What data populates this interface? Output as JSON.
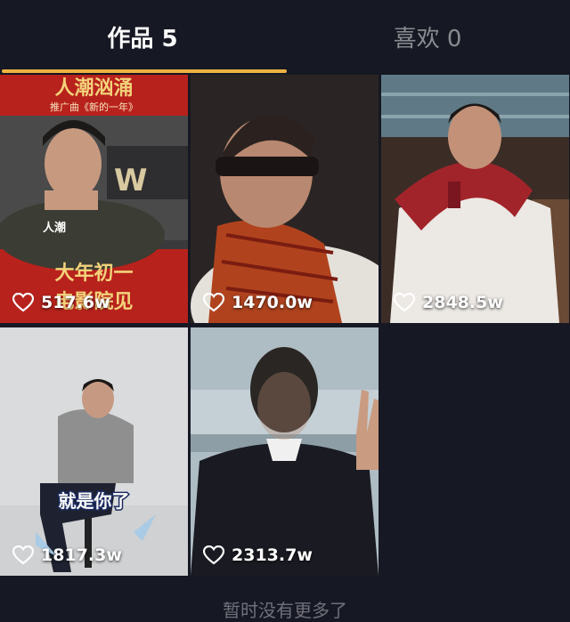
{
  "tabs": [
    {
      "label": "作品 5",
      "active": true
    },
    {
      "label": "喜欢 0",
      "active": false
    }
  ],
  "videos": [
    {
      "likes": "517.6w",
      "overlay": {
        "top": "人潮汹涌",
        "subtitle": "推广曲《新的一年》",
        "tag": "人潮",
        "bottom_line1": "大年初一",
        "bottom_line2": "电影院见"
      }
    },
    {
      "likes": "1470.0w"
    },
    {
      "likes": "2848.5w"
    },
    {
      "likes": "1817.3w",
      "overlay": {
        "caption": "就是你了"
      }
    },
    {
      "likes": "2313.7w"
    }
  ],
  "footer_text": "暂时没有更多了",
  "colors": {
    "background": "#161823",
    "accent": "#f0b342",
    "inactive_tab": "#8a8b91"
  }
}
